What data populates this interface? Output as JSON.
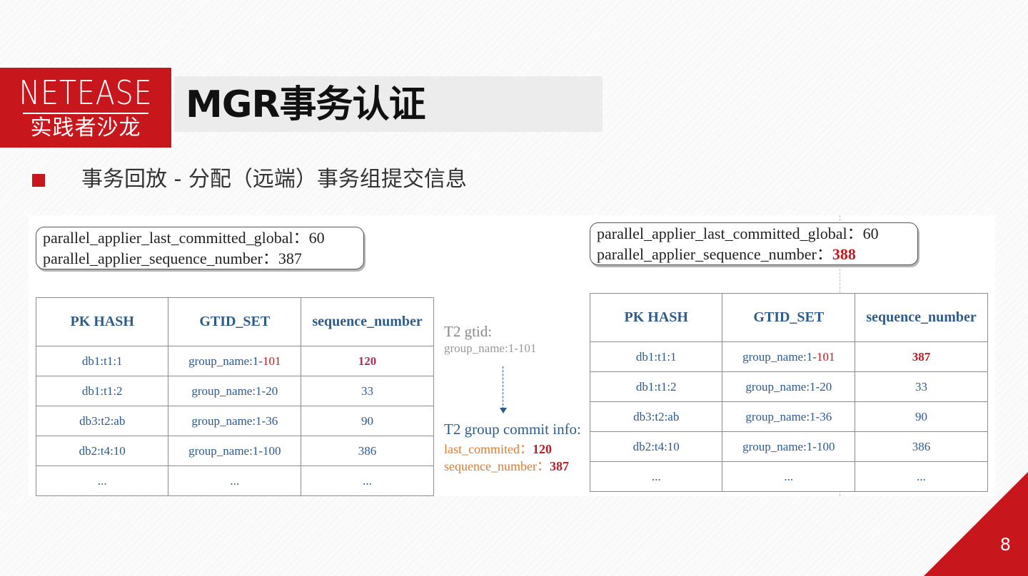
{
  "brand": {
    "logo_top": "NETEASE",
    "logo_bottom": "实践者沙龙"
  },
  "slide": {
    "title": "MGR事务认证",
    "subtitle": "事务回放 -  分配（远端）事务组提交信息",
    "page_number": "8"
  },
  "colors": {
    "accent": "#c8161d",
    "table_text": "#2b5a8f",
    "orange": "#e07a2f"
  },
  "left": {
    "callout": {
      "line1_label": "parallel_applier_last_committed_global：",
      "line1_value": "60",
      "line2_label": "parallel_applier_sequence_number：",
      "line2_value": "387"
    },
    "table": {
      "headers": [
        "PK HASH",
        "GTID_SET",
        "sequence_number"
      ],
      "rows": [
        {
          "pk": "db1:t1:1",
          "gtid_prefix": "group_name:1-",
          "gtid_suffix": "101",
          "seq": "120"
        },
        {
          "pk": "db1:t1:2",
          "gtid_prefix": "group_name:1-20",
          "gtid_suffix": "",
          "seq": "33"
        },
        {
          "pk": "db3:t2:ab",
          "gtid_prefix": "group_name:1-36",
          "gtid_suffix": "",
          "seq": "90"
        },
        {
          "pk": "db2:t4:10",
          "gtid_prefix": "group_name:1-100",
          "gtid_suffix": "",
          "seq": "386"
        },
        {
          "pk": "...",
          "gtid_prefix": "...",
          "gtid_suffix": "",
          "seq": "..."
        }
      ]
    }
  },
  "middle": {
    "t2_gtid_title": "T2 gtid:",
    "t2_gtid_value": "group_name:1-101",
    "commit_title": "T2 group commit info:",
    "last_commited_label": "last_commited：",
    "last_commited_value": "120",
    "sequence_number_label": "sequence_number：",
    "sequence_number_value": "387"
  },
  "right": {
    "callout": {
      "line1_label": "parallel_applier_last_committed_global：",
      "line1_value": "60",
      "line2_label": "parallel_applier_sequence_number：",
      "line2_value": "388"
    },
    "table": {
      "headers": [
        "PK HASH",
        "GTID_SET",
        "sequence_number"
      ],
      "rows": [
        {
          "pk": "db1:t1:1",
          "gtid_prefix": "group_name:1-",
          "gtid_suffix": "101",
          "seq": "387"
        },
        {
          "pk": "db1:t1:2",
          "gtid_prefix": "group_name:1-20",
          "gtid_suffix": "",
          "seq": "33"
        },
        {
          "pk": "db3:t2:ab",
          "gtid_prefix": "group_name:1-36",
          "gtid_suffix": "",
          "seq": "90"
        },
        {
          "pk": "db2:t4:10",
          "gtid_prefix": "group_name:1-100",
          "gtid_suffix": "",
          "seq": "386"
        },
        {
          "pk": "...",
          "gtid_prefix": "...",
          "gtid_suffix": "",
          "seq": "..."
        }
      ]
    }
  }
}
